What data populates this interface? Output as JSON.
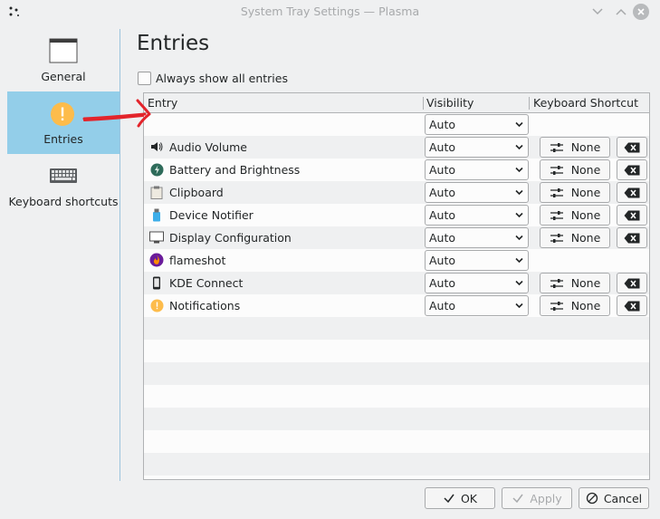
{
  "window": {
    "title": "System Tray Settings — Plasma"
  },
  "sidebar": {
    "items": [
      {
        "label": "General",
        "icon": "window-icon"
      },
      {
        "label": "Entries",
        "icon": "info-exclamation-icon",
        "active": true
      },
      {
        "label": "Keyboard shortcuts",
        "icon": "keyboard-icon"
      }
    ]
  },
  "main": {
    "title": "Entries",
    "always_show_label": "Always show all entries"
  },
  "table": {
    "headers": {
      "entry": "Entry",
      "visibility": "Visibility",
      "shortcut": "Keyboard Shortcut"
    },
    "rows": [
      {
        "name": "",
        "icon": "",
        "visibility": "Auto",
        "shortcut": null
      },
      {
        "name": "Audio Volume",
        "icon": "speaker-icon",
        "visibility": "Auto",
        "shortcut": "None"
      },
      {
        "name": "Battery and Brightness",
        "icon": "battery-icon",
        "visibility": "Auto",
        "shortcut": "None"
      },
      {
        "name": "Clipboard",
        "icon": "clipboard-icon",
        "visibility": "Auto",
        "shortcut": "None"
      },
      {
        "name": "Device Notifier",
        "icon": "usb-device-icon",
        "visibility": "Auto",
        "shortcut": "None"
      },
      {
        "name": "Display Configuration",
        "icon": "monitor-icon",
        "visibility": "Auto",
        "shortcut": "None"
      },
      {
        "name": "flameshot",
        "icon": "flameshot-icon",
        "visibility": "Auto",
        "shortcut": null
      },
      {
        "name": "KDE Connect",
        "icon": "phone-icon",
        "visibility": "Auto",
        "shortcut": "None"
      },
      {
        "name": "Notifications",
        "icon": "notification-icon",
        "visibility": "Auto",
        "shortcut": "None"
      }
    ]
  },
  "footer": {
    "ok": "OK",
    "apply": "Apply",
    "cancel": "Cancel"
  },
  "colors": {
    "accent": "#93cee9",
    "annotation": "#e3242b"
  }
}
